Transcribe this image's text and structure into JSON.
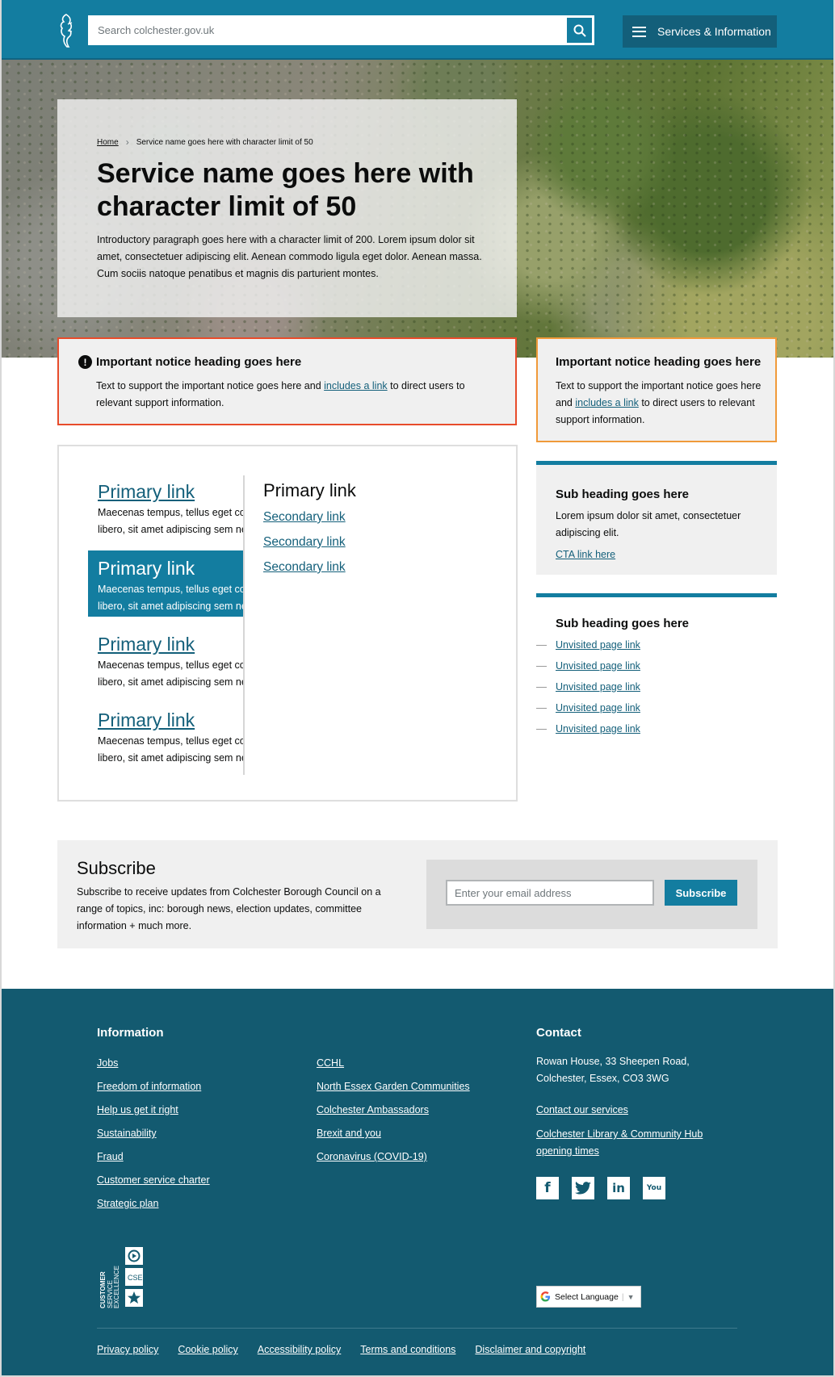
{
  "header": {
    "search_placeholder": "Search colchester.gov.uk",
    "menu_label": "Services & Information"
  },
  "hero": {
    "breadcrumb_home": "Home",
    "breadcrumb_current": "Service name goes here with character limit of 50",
    "title": "Service name goes here with character limit of 50",
    "intro": "Introductory paragraph goes here with a character limit of 200. Lorem ipsum dolor sit amet, consectetuer adipiscing elit. Aenean commodo ligula eget dolor. Aenean massa. Cum sociis natoque penatibus et magnis dis parturient montes."
  },
  "notice_red": {
    "heading": "Important notice heading goes here",
    "text_before": "Text to support the important notice goes here and ",
    "link": "includes a link",
    "text_after": " to direct users to relevant support information."
  },
  "notice_orange": {
    "heading": "Important notice heading goes here",
    "text_before": "Text to support the important notice goes here and ",
    "link": "includes a link",
    "text_after": " to direct users to relevant support information."
  },
  "links_card": {
    "primary_items": [
      {
        "label": "Primary link",
        "desc_1": "Maecenas tempus, tellus eget condimentum",
        "desc_2": "libero, sit amet adipiscing sem neque sed"
      },
      {
        "label": "Primary link",
        "desc_1": "Maecenas tempus, tellus eget condimentum",
        "desc_2": "libero, sit amet adipiscing sem neque sed"
      },
      {
        "label": "Primary link",
        "desc_1": "Maecenas tempus, tellus eget condimentum",
        "desc_2": "libero, sit amet adipiscing sem neque sed"
      },
      {
        "label": "Primary link",
        "desc_1": "Maecenas tempus, tellus eget condimentum",
        "desc_2": "libero, sit amet adipiscing sem neque sed"
      }
    ],
    "active_index": 1,
    "right_heading": "Primary link",
    "secondary_links": [
      "Secondary link",
      "Secondary link",
      "Secondary link"
    ]
  },
  "sub_box": {
    "heading": "Sub heading goes here",
    "text": "Lorem ipsum dolor sit amet, consectetuer adipiscing elit.",
    "cta": "CTA link here"
  },
  "sub_list": {
    "heading": "Sub heading goes here",
    "links": [
      "Unvisited page link",
      "Unvisited page link",
      "Unvisited page link",
      "Unvisited page link",
      "Unvisited page link"
    ]
  },
  "subscribe": {
    "heading": "Subscribe",
    "text": "Subscribe to receive updates from Colchester Borough Council on a range of topics, inc: borough news, election updates, committee information + much more.",
    "email_placeholder": "Enter your email address",
    "button": "Subscribe"
  },
  "footer": {
    "info_heading": "Information",
    "info_links_col1": [
      "Jobs",
      "Freedom of information",
      "Help us get it right",
      "Sustainability",
      "Fraud",
      "Customer service charter",
      "Strategic plan"
    ],
    "info_links_col2": [
      "CCHL",
      "North Essex Garden Communities",
      "Colchester Ambassadors",
      "Brexit and you",
      "Coronavirus (COVID-19)"
    ],
    "contact_heading": "Contact",
    "address_line1": "Rowan House, 33 Sheepen Road,",
    "address_line2": "Colchester, Essex, CO3 3WG",
    "contact_links": [
      "Contact our services",
      "Colchester Library & Community Hub opening times"
    ],
    "social": [
      {
        "name": "facebook-icon",
        "glyph": "f"
      },
      {
        "name": "twitter-icon",
        "glyph": "t"
      },
      {
        "name": "linkedin-icon",
        "glyph": "in"
      },
      {
        "name": "youtube-icon",
        "glyph": "You"
      }
    ],
    "cse_text": "CUSTOMER SERVICE EXCELLENCE",
    "cse_badge": "CSE",
    "language_label": "Select Language",
    "bottom_links": [
      "Privacy policy",
      "Cookie policy",
      "Accessibility policy",
      "Terms and conditions",
      "Disclaimer and copyright"
    ]
  },
  "colors": {
    "brand_teal": "#137da0",
    "dark_teal": "#135a70",
    "alert_red": "#e84c2b",
    "warning_orange": "#f09a3a"
  }
}
